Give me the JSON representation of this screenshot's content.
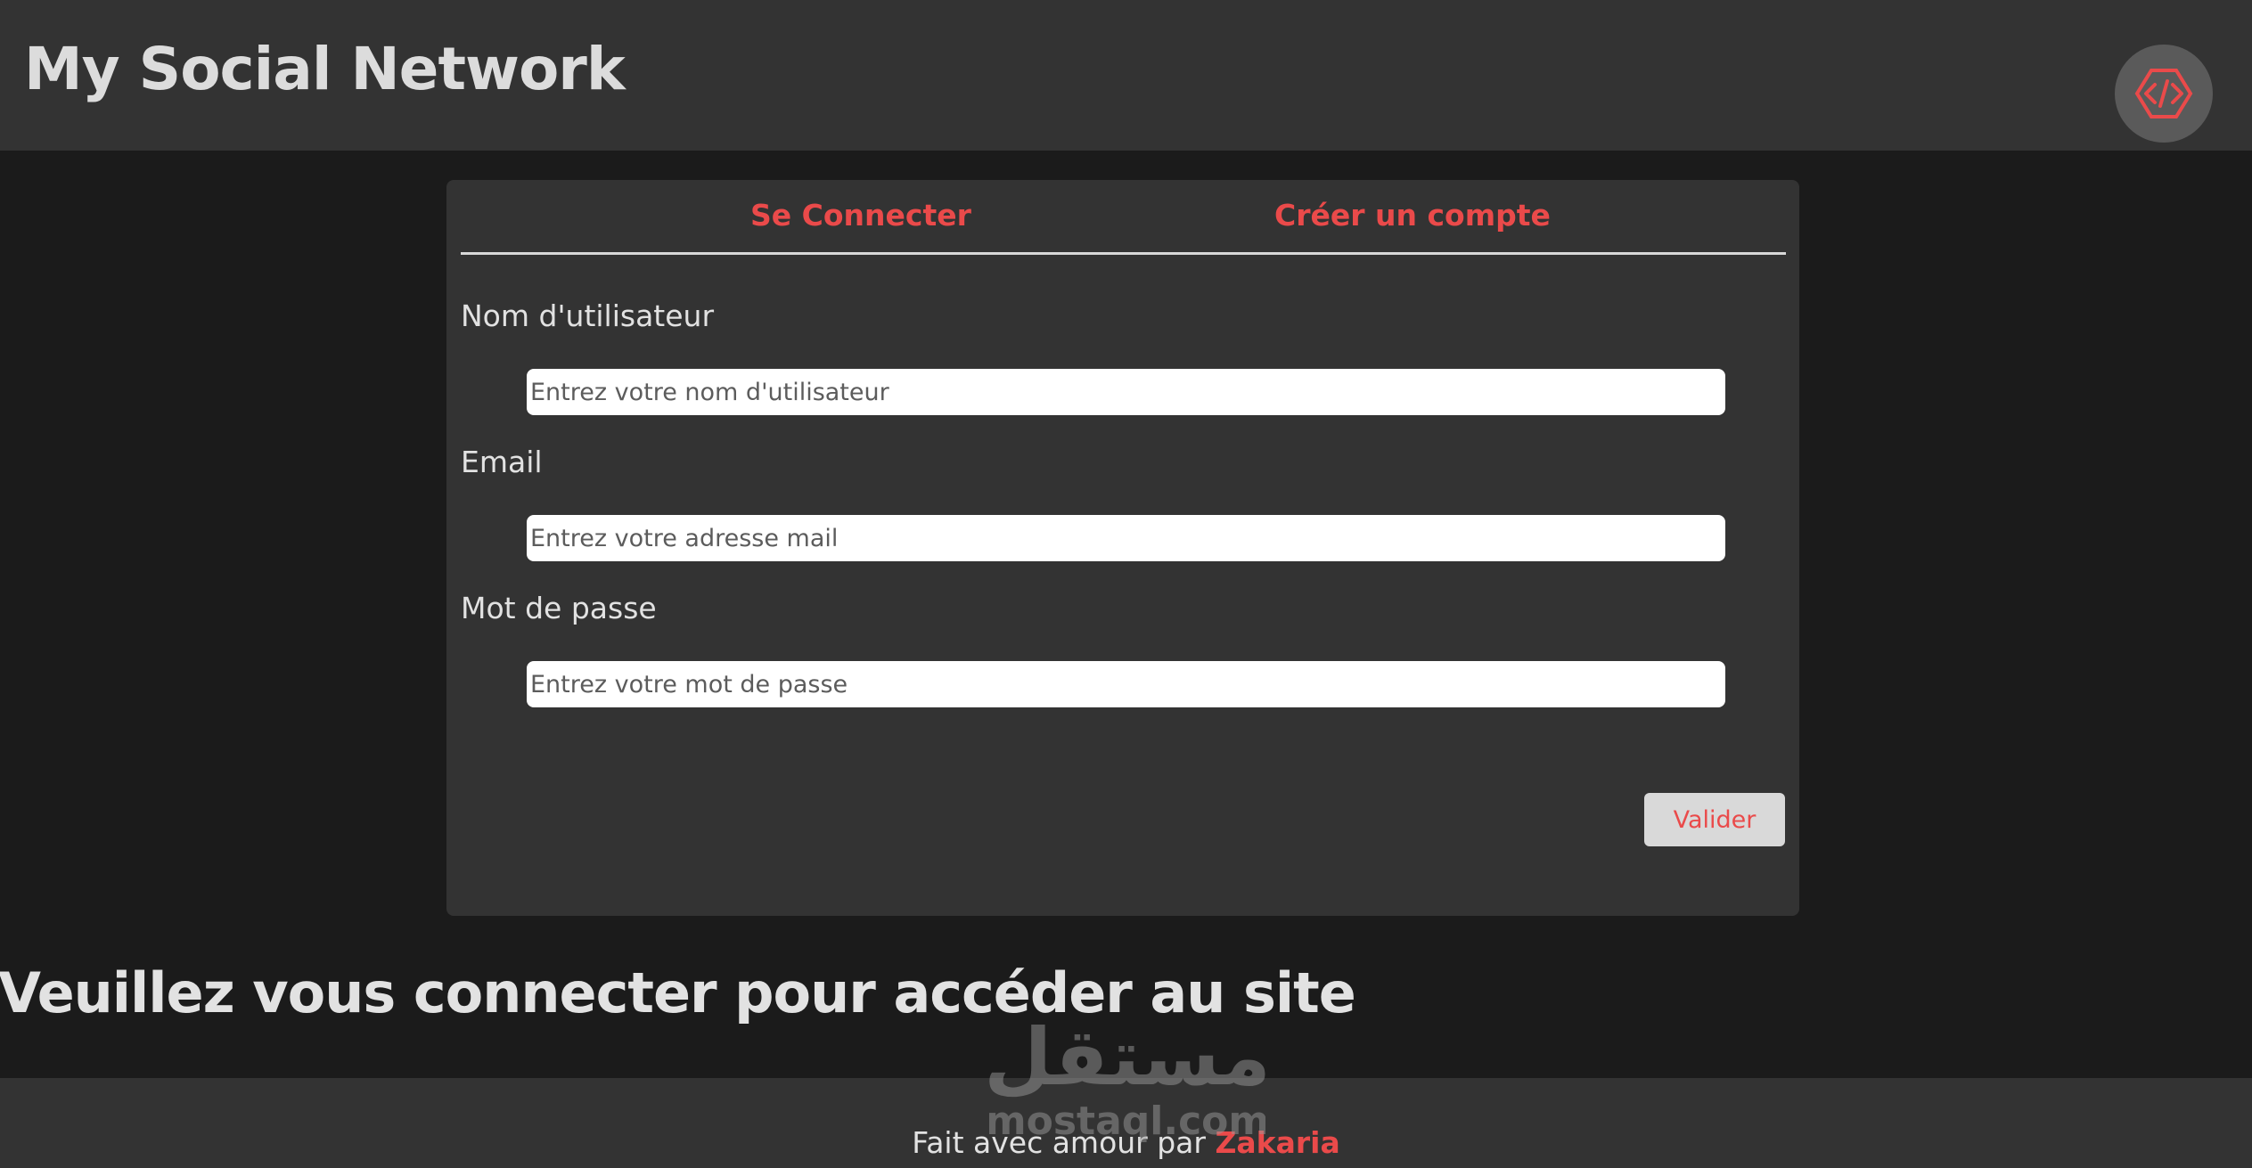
{
  "header": {
    "title": "My Social Network",
    "logo_icon": "code-logo-icon"
  },
  "auth_card": {
    "tabs": [
      {
        "label": "Se Connecter"
      },
      {
        "label": "Créer un compte"
      }
    ],
    "fields": [
      {
        "label": "Nom d'utilisateur",
        "placeholder": "Entrez votre nom d'utilisateur",
        "value": ""
      },
      {
        "label": "Email",
        "placeholder": "Entrez votre adresse mail",
        "value": ""
      },
      {
        "label": "Mot de passe",
        "placeholder": "Entrez votre mot de passe",
        "value": ""
      }
    ],
    "submit_label": "Valider"
  },
  "notice": "Veuillez vous connecter pour accéder au site",
  "footer": {
    "text": "Fait avec amour par ",
    "author": "Zakaria"
  },
  "watermark": {
    "arabic": "مستقل",
    "latin": "mostaql.com"
  },
  "colors": {
    "accent": "#ea4a4a",
    "header_bg": "#333333",
    "page_bg": "#1b1b1b",
    "card_bg": "#333333",
    "text": "#e2e2e2"
  }
}
